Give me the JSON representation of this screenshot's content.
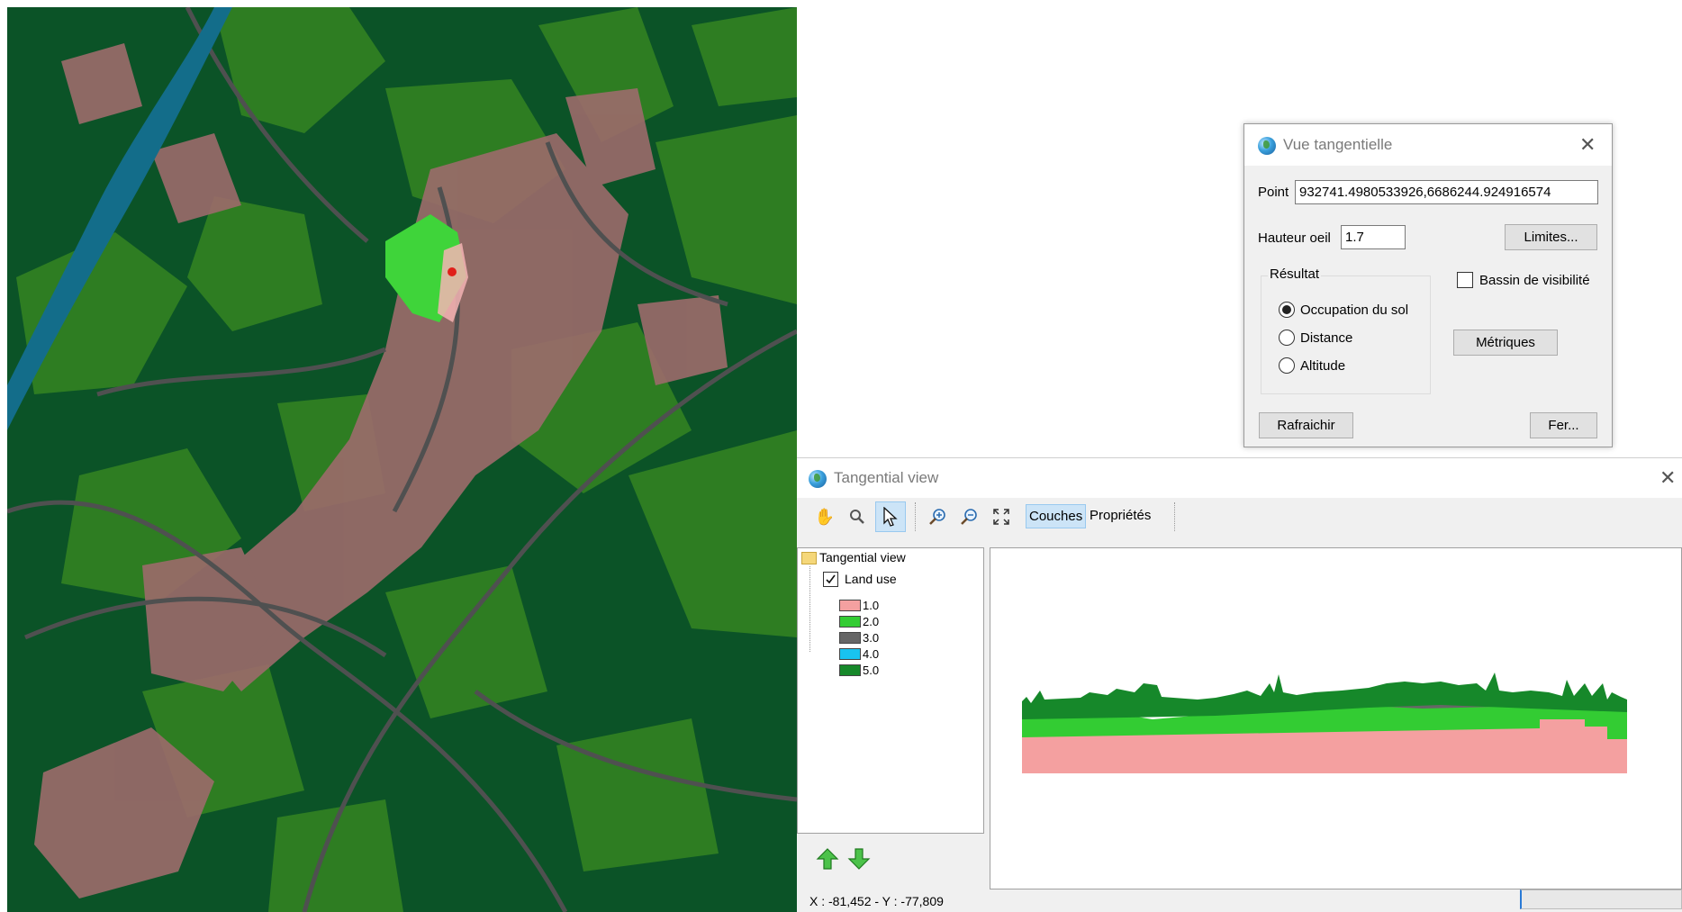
{
  "dialog": {
    "title": "Vue tangentielle",
    "point_label": "Point",
    "point_value": "932741.4980533926,6686244.924916574",
    "eye_height_label": "Hauteur oeil",
    "eye_height_value": "1.7",
    "limits_button": "Limites...",
    "result_group": "Résultat",
    "result_options": [
      {
        "label": "Occupation du sol",
        "selected": true
      },
      {
        "label": "Distance",
        "selected": false
      },
      {
        "label": "Altitude",
        "selected": false
      }
    ],
    "visibility_basin_label": "Bassin de visibilité",
    "visibility_basin_checked": false,
    "metrics_button": "Métriques",
    "refresh_button": "Rafraichir",
    "close_button": "Fer..."
  },
  "tangential_window": {
    "title": "Tangential view",
    "toolbar": {
      "icons": [
        "pan-hand-icon",
        "magnifier-icon",
        "pointer-arrow-icon",
        "zoom-in-icon",
        "zoom-out-icon",
        "zoom-extent-icon"
      ],
      "tabs": [
        {
          "label": "Couches",
          "active": true
        },
        {
          "label": "Propriétés",
          "active": false
        }
      ]
    },
    "tree": {
      "root": "Tangential view",
      "layer": "Land use",
      "layer_checked": true,
      "legend": [
        {
          "label": "1.0",
          "color": "#f4a0a0"
        },
        {
          "label": "2.0",
          "color": "#33cc33"
        },
        {
          "label": "3.0",
          "color": "#666666"
        },
        {
          "label": "4.0",
          "color": "#19c3f0"
        },
        {
          "label": "5.0",
          "color": "#16882a"
        }
      ]
    },
    "status": "X : -81,452 - Y : -77,809"
  },
  "map": {
    "colors": {
      "forest": "#0b5327",
      "meadow": "#2e7d22",
      "urban": "#9c6b6b",
      "roads": "#4f5050",
      "water": "#136d8a",
      "visible_area": "#3fd43a",
      "observer_point": "#e0201a"
    }
  }
}
